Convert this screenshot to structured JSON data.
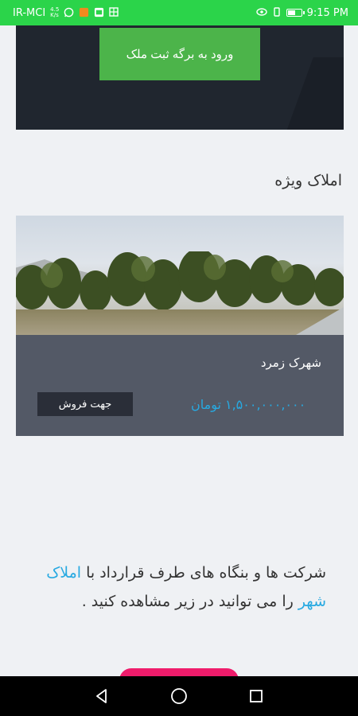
{
  "status_bar": {
    "carrier": "IR-MCI",
    "network_speed_top": "4.5",
    "network_speed_bottom": "K/s",
    "time": "9:15 PM",
    "battery_level": 0.6
  },
  "hero": {
    "cta_label": "ورود به برگه ثبت ملک"
  },
  "featured": {
    "title": "املاک ویژه",
    "listing": {
      "name": "شهرک زمرد",
      "price": "۱,۵۰۰,۰۰۰,۰۰۰ تومان",
      "badge": "جهت فروش"
    }
  },
  "partners": {
    "text_before": "شرکت ها و بنگاه های طرف قرارداد با ",
    "highlight": "املاک شهر",
    "text_after": " را می توانید در زیر مشاهده کنید ."
  },
  "icons": {
    "back": "back-icon",
    "home": "home-icon",
    "recents": "recents-icon"
  },
  "colors": {
    "status_bar": "#2bd44a",
    "cta": "#4cb44a",
    "price": "#27a9e1",
    "pink": "#ef1c6b"
  }
}
